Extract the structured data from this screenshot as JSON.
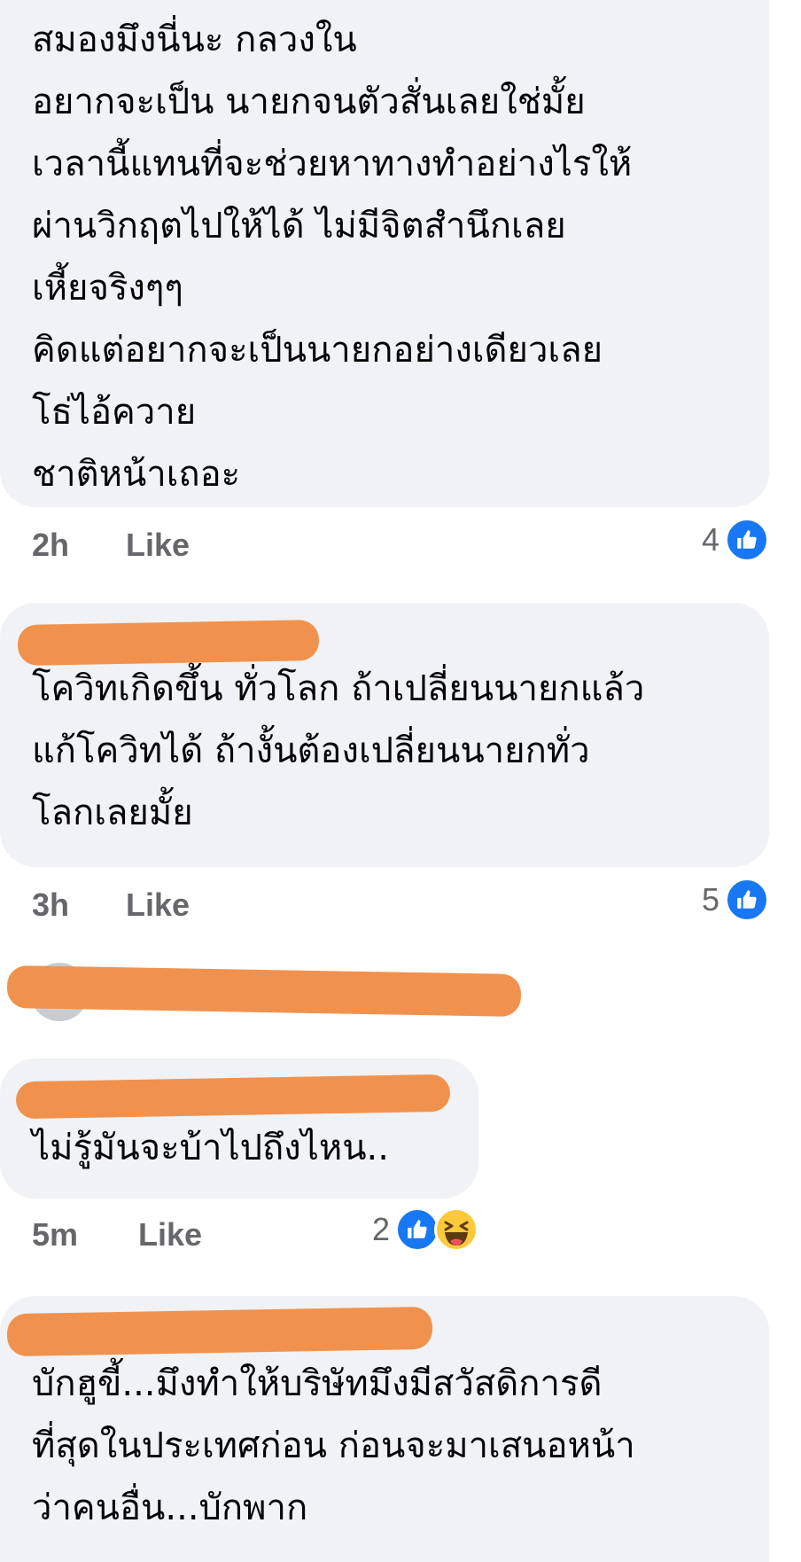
{
  "comments": [
    {
      "lines": [
        "สมองมึงนี่นะ กลวงใน",
        "อยากจะเป็น นายกจนตัวสั่นเลยใช่มั้ย",
        "เวลานี้แทนที่จะช่วยหาทางทำอย่างไรให้",
        "ผ่านวิกฤตไปให้ได้ ไม่มีจิตสำนึกเลย",
        "เหี้ยจริงๆๆ",
        "คิดแต่อยากจะเป็นนายกอย่างเดียวเลย",
        "โธ่ไอ้ควาย",
        "ชาติหน้าเถอะ"
      ],
      "time": "2h",
      "like_label": "Like",
      "reaction_count": "4",
      "reactions": [
        "like-icon"
      ]
    },
    {
      "lines": [
        "โควิทเกิดขึ้น ทั่วโลก ถ้าเปลี่ยนนายกแล้ว",
        "แก้โควิทได้ ถ้างั้นต้องเปลี่ยนนายกทั่ว",
        "โลกเลยมั้ย"
      ],
      "time": "3h",
      "like_label": "Like",
      "reaction_count": "5",
      "reactions": [
        "like-icon"
      ]
    },
    {
      "lines": [
        "ไม่รู้มันจะบ้าไปถึงไหน.."
      ],
      "time": "5m",
      "like_label": "Like",
      "reaction_count": "2",
      "reactions": [
        "like-icon",
        "haha-icon"
      ]
    },
    {
      "lines": [
        "บักฮูขี้...มึงทำให้บริษัทมึงมีสวัสดิการดี",
        "ที่สุดในประเทศก่อน ก่อนจะมาเสนอหน้า",
        "ว่าคนอื่น...บักพาก"
      ]
    }
  ],
  "colors": {
    "bubble": "#f0f2f5",
    "meta_text": "#65676b",
    "like_blue": "#1877f2",
    "haha_yellow": "#fcc93a",
    "redaction": "#f0924e"
  }
}
